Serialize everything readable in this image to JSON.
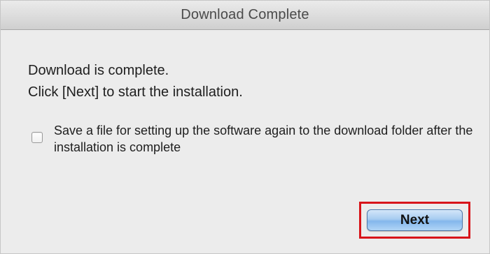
{
  "window": {
    "title": "Download Complete"
  },
  "message": {
    "line1": "Download is complete.",
    "line2": "Click [Next] to start the installation."
  },
  "save_option": {
    "checked": false,
    "label": "Save a file for setting up the software again to the download folder after the installation is complete"
  },
  "buttons": {
    "next_label": "Next"
  },
  "colors": {
    "highlight_border": "#d8141a",
    "button_blue": "#a7ccf1",
    "background": "#ececec"
  }
}
